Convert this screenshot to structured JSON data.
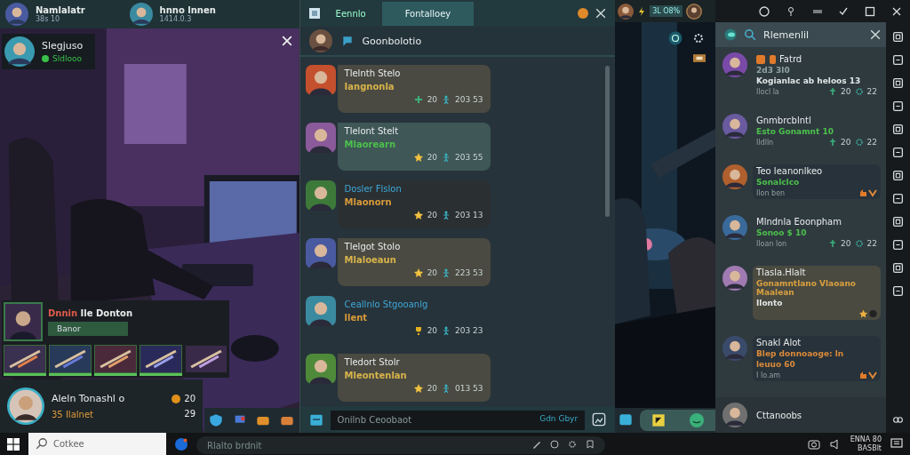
{
  "stream_header": {
    "users": [
      {
        "name": "Namlalatr",
        "info": "38s 10"
      },
      {
        "name": "hnno lnnen",
        "info": "1414.0.3"
      }
    ]
  },
  "stream": {
    "profile": {
      "name": "Slegjuso",
      "status": "Sldlooo"
    },
    "loadout": {
      "accent": "Dnnin",
      "title": "Ile Donton",
      "button": "Banor",
      "items": [
        {
          "equipped": true
        },
        {
          "equipped": true
        },
        {
          "equipped": true
        },
        {
          "equipped": true
        },
        {
          "equipped": false
        }
      ]
    },
    "viewer": {
      "name": "Aleln Tonashl o",
      "info": "35 Ilalnet",
      "count_1": "20",
      "count_2": "29"
    }
  },
  "chat": {
    "tabs": [
      {
        "label": "Eennlo",
        "selected": false
      },
      {
        "label": "Fontalloey",
        "selected": true
      }
    ],
    "channel": "Goonbolotio",
    "messages": [
      {
        "kind": "pinned",
        "name": "Tlelnth Stelo",
        "text": "Iangnonla",
        "color": "#d8b44a",
        "count": "20",
        "score": "203 53"
      },
      {
        "kind": "guild",
        "name": "Tlelont Stelt",
        "text": "Mlaorearn",
        "color": "#4cc04c",
        "count": "20",
        "score": "203 55"
      },
      {
        "kind": "guest",
        "name": "Dosler Flslon",
        "text": "Mlaonorn",
        "color": "#d89a3a",
        "count": "20",
        "score": "203 13"
      },
      {
        "kind": "member",
        "name": "Tlelgot Stolo",
        "text": "Mlaloeaun",
        "color": "#d8b44a",
        "count": "20",
        "score": "223 53"
      },
      {
        "kind": "bot",
        "name": "Ceallnlo Stgooanlg",
        "text": "llent",
        "color": "#d89a3a",
        "count": "20",
        "score": "203 23"
      },
      {
        "kind": "member",
        "name": "Tledort Stolr",
        "text": "Mleontenlan",
        "color": "#d8b44a",
        "count": "20",
        "score": "013 53"
      }
    ],
    "input": {
      "placeholder": "Onilnb Ceoobaot",
      "action": "Gdn Gbyr"
    }
  },
  "game": {
    "badge": "3L O8%"
  },
  "side_chat": {
    "title": "Rlemenlil",
    "messages": [
      {
        "kind": "post",
        "name": "Fatrd",
        "tags": true,
        "lines": [
          {
            "text": "2d3 3l0",
            "color": "#8fa3a3"
          },
          {
            "text": "Kogianlac ab heloos 13",
            "color": "#dfe6e6"
          }
        ],
        "time": "Ilocl la",
        "count": "20",
        "score": "22"
      },
      {
        "kind": "post",
        "name": "Gnmbrcblntl",
        "tags": false,
        "lines": [
          {
            "text": "Esto Gonamnt 10",
            "color": "#4cc04c"
          }
        ],
        "time": "Ildlln",
        "count": "20",
        "score": "22"
      },
      {
        "kind": "reply",
        "name": "Teo leanonlkeo",
        "tags": false,
        "lines": [
          {
            "text": "Sonalclco",
            "color": "#4cc04c"
          }
        ],
        "time": "Ilon ben"
      },
      {
        "kind": "post",
        "name": "Mlndnla Eoonpham",
        "tags": false,
        "lines": [
          {
            "text": "Sonoo $ 10",
            "color": "#4cc04c"
          }
        ],
        "time": "Iloan lon",
        "count": "20",
        "score": "22"
      },
      {
        "kind": "featured",
        "name": "Tlasla.Hlalt",
        "tags": false,
        "lines": [
          {
            "text": "Gonamntlano Vlaoano Maalean",
            "color": "#d9a040"
          },
          {
            "text": "Ilonto",
            "color": "#dfe6e6"
          }
        ]
      },
      {
        "kind": "reply",
        "name": "Snakl Alot",
        "tags": false,
        "lines": [
          {
            "text": "Blep donnoaoge: ln",
            "color": "#d98a3a"
          },
          {
            "text": "leuuo 60",
            "color": "#d98a3a"
          }
        ],
        "time": "I lo.am"
      },
      {
        "kind": "footer",
        "name": "Cttanoobs",
        "tags": false
      }
    ]
  },
  "taskbar": {
    "search": {
      "placeholder": "Cotkee"
    },
    "field": {
      "placeholder": "Rlalto brdnit"
    },
    "clock": {
      "time": "ENNA 80",
      "date": "BASBlt"
    }
  }
}
